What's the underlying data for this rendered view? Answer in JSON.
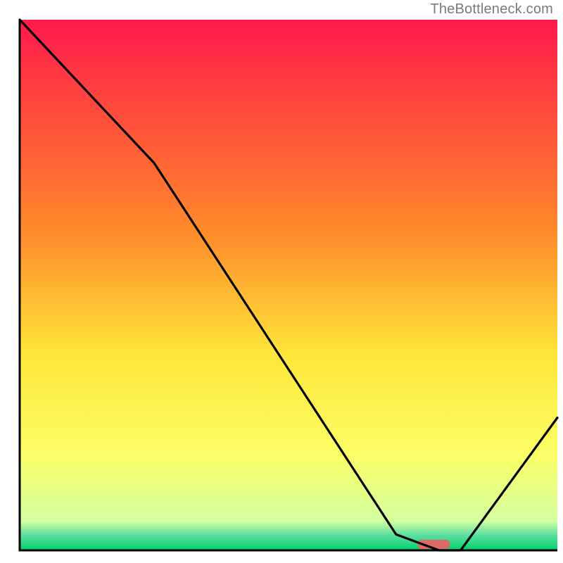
{
  "watermark": "TheBottleneck.com",
  "chart_data": {
    "type": "line",
    "title": "",
    "xlabel": "",
    "ylabel": "",
    "xlim": [
      0,
      100
    ],
    "ylim": [
      0,
      100
    ],
    "x": [
      0,
      25,
      70,
      78,
      82,
      100
    ],
    "values": [
      100,
      73,
      3,
      0,
      0,
      25
    ],
    "optimal_x_range": [
      72,
      82
    ],
    "gradient_stops": [
      {
        "offset": 0.0,
        "color": "#ff1a4b"
      },
      {
        "offset": 0.4,
        "color": "#ff8a2a"
      },
      {
        "offset": 0.63,
        "color": "#ffe63a"
      },
      {
        "offset": 0.82,
        "color": "#fbff66"
      },
      {
        "offset": 0.945,
        "color": "#d3ffa0"
      },
      {
        "offset": 0.97,
        "color": "#60e0a0"
      },
      {
        "offset": 1.0,
        "color": "#00d070"
      }
    ],
    "marker": {
      "x": 77,
      "color": "#e06868"
    }
  }
}
